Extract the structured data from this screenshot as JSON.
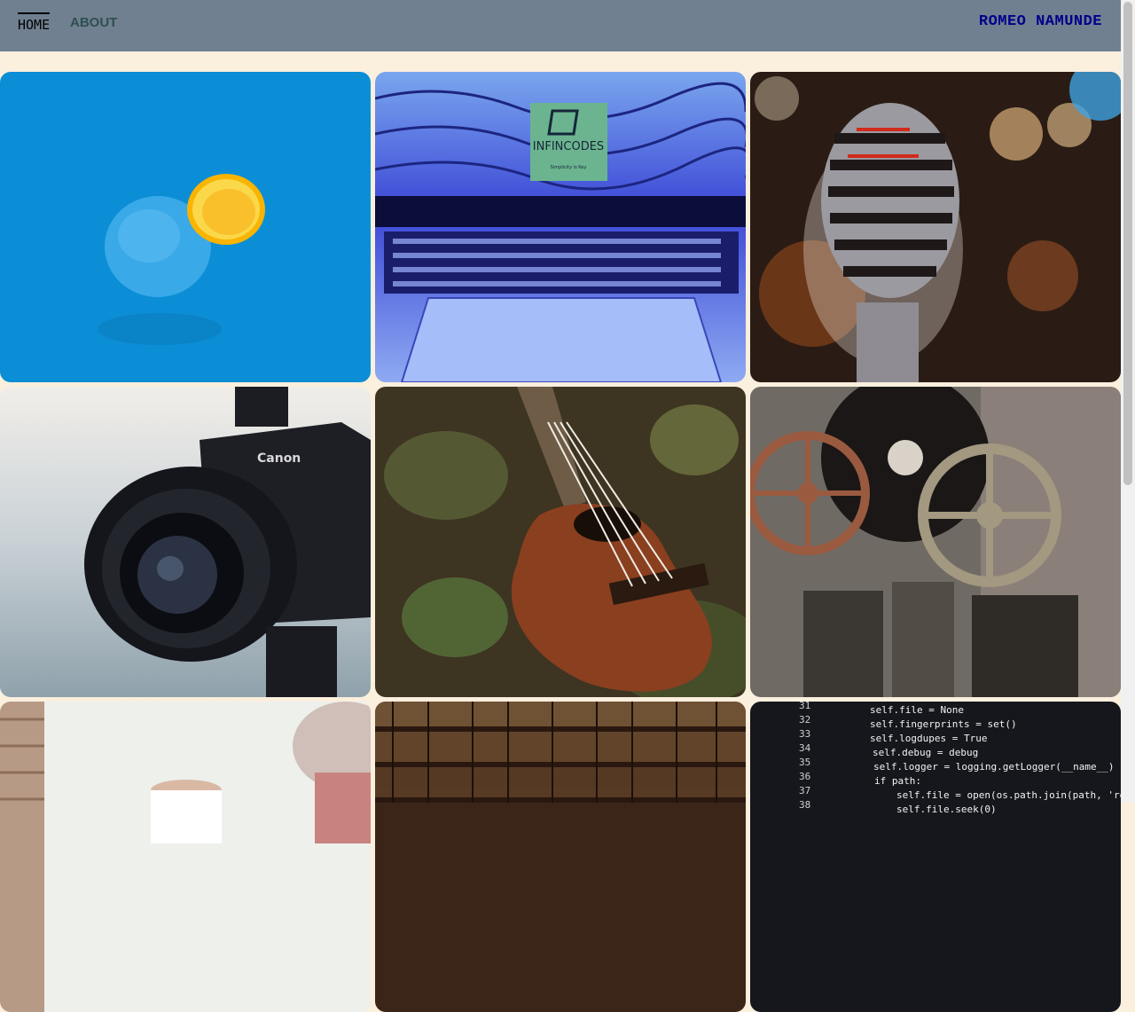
{
  "nav": {
    "home_label": "HOME",
    "about_label": "ABOUT",
    "brand": "ROMEO NAMUNDE"
  },
  "gallery": {
    "logo_text": "INFINCODES",
    "logo_tagline": "Simplicity is Key",
    "camera_brand": "Canon",
    "code_line_numbers": [
      "31",
      "32",
      "33",
      "34",
      "35",
      "36",
      "37",
      "38"
    ],
    "code_lines": [
      "self.file = None",
      "self.fingerprints = set()",
      "self.logdupes = True",
      "self.debug = debug",
      "self.logger = logging.getLogger(__name__)",
      "if path:",
      "self.file = open(os.path.join(path, 'requests.seen'), 'a+')",
      "self.file.seek(0)"
    ]
  },
  "colors": {
    "nav_bg": "#708090",
    "page_bg": "#fbefde",
    "brand": "#00008b",
    "about": "#2f4f4f"
  }
}
